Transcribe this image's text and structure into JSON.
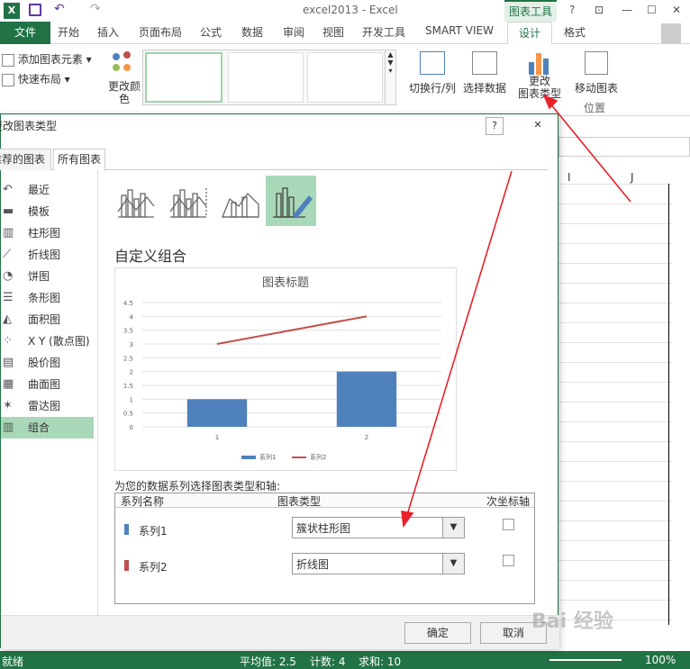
{
  "titlebar": {
    "app_title": "excel2013 - Excel",
    "chart_tools": "图表工具",
    "help": "?"
  },
  "ribbon_tabs": [
    "文件",
    "开始",
    "插入",
    "页面布局",
    "公式",
    "数据",
    "审阅",
    "视图",
    "开发工具",
    "SMART VIEW",
    "设计",
    "格式"
  ],
  "ribbon": {
    "add_element": "添加图表元素",
    "quick_layout": "快速布局",
    "change_colors": "更改颜色",
    "switch_row_col": "切换行/列",
    "select_data": "选择数据",
    "change_type_l1": "更改",
    "change_type_l2": "图表类型",
    "move_chart": "移动图表",
    "group_location": "位置"
  },
  "sheet": {
    "col_i": "I",
    "col_j": "J"
  },
  "dialog": {
    "title": "更改图表类型",
    "tab_recommended": "推荐的图表",
    "tab_all": "所有图表",
    "categories": [
      {
        "label": "最近",
        "icon": "undo-icon"
      },
      {
        "label": "模板",
        "icon": "folder-icon"
      },
      {
        "label": "柱形图",
        "icon": "column-chart-icon"
      },
      {
        "label": "折线图",
        "icon": "line-chart-icon"
      },
      {
        "label": "饼图",
        "icon": "pie-chart-icon"
      },
      {
        "label": "条形图",
        "icon": "bar-chart-icon"
      },
      {
        "label": "面积图",
        "icon": "area-chart-icon"
      },
      {
        "label": "X Y (散点图)",
        "icon": "scatter-chart-icon"
      },
      {
        "label": "股价图",
        "icon": "stock-chart-icon"
      },
      {
        "label": "曲面图",
        "icon": "surface-chart-icon"
      },
      {
        "label": "雷达图",
        "icon": "radar-chart-icon"
      },
      {
        "label": "组合",
        "icon": "combo-chart-icon"
      }
    ],
    "selected_category": 11,
    "section_title": "自定义组合",
    "axis_prompt": "为您的数据系列选择图表类型和轴:",
    "table_headers": {
      "name": "系列名称",
      "type": "图表类型",
      "secondary": "次坐标轴"
    },
    "series_rows": [
      {
        "name": "系列1",
        "type": "簇状柱形图",
        "color": "#4f81bd",
        "secondary": false
      },
      {
        "name": "系列2",
        "type": "折线图",
        "color": "#c0504d",
        "secondary": false
      }
    ],
    "ok": "确定",
    "cancel": "取消"
  },
  "chart_data": {
    "type": "bar",
    "title": "图表标题",
    "categories": [
      "1",
      "2"
    ],
    "series": [
      {
        "name": "系列1",
        "kind": "bar",
        "values": [
          1,
          2
        ],
        "color": "#4f81bd"
      },
      {
        "name": "系列2",
        "kind": "line",
        "values": [
          3,
          4
        ],
        "color": "#c0504d"
      }
    ],
    "ylim": [
      0,
      4.5
    ],
    "yticks": [
      "0",
      "0.5",
      "1",
      "1.5",
      "2",
      "2.5",
      "3",
      "3.5",
      "4",
      "4.5"
    ],
    "grid": true,
    "legend": "bottom"
  },
  "statusbar": {
    "ready": "就绪",
    "average": "平均值: 2.5",
    "count": "计数: 4",
    "sum": "求和: 10",
    "zoom": "100%"
  },
  "watermark": "Bai 经验"
}
